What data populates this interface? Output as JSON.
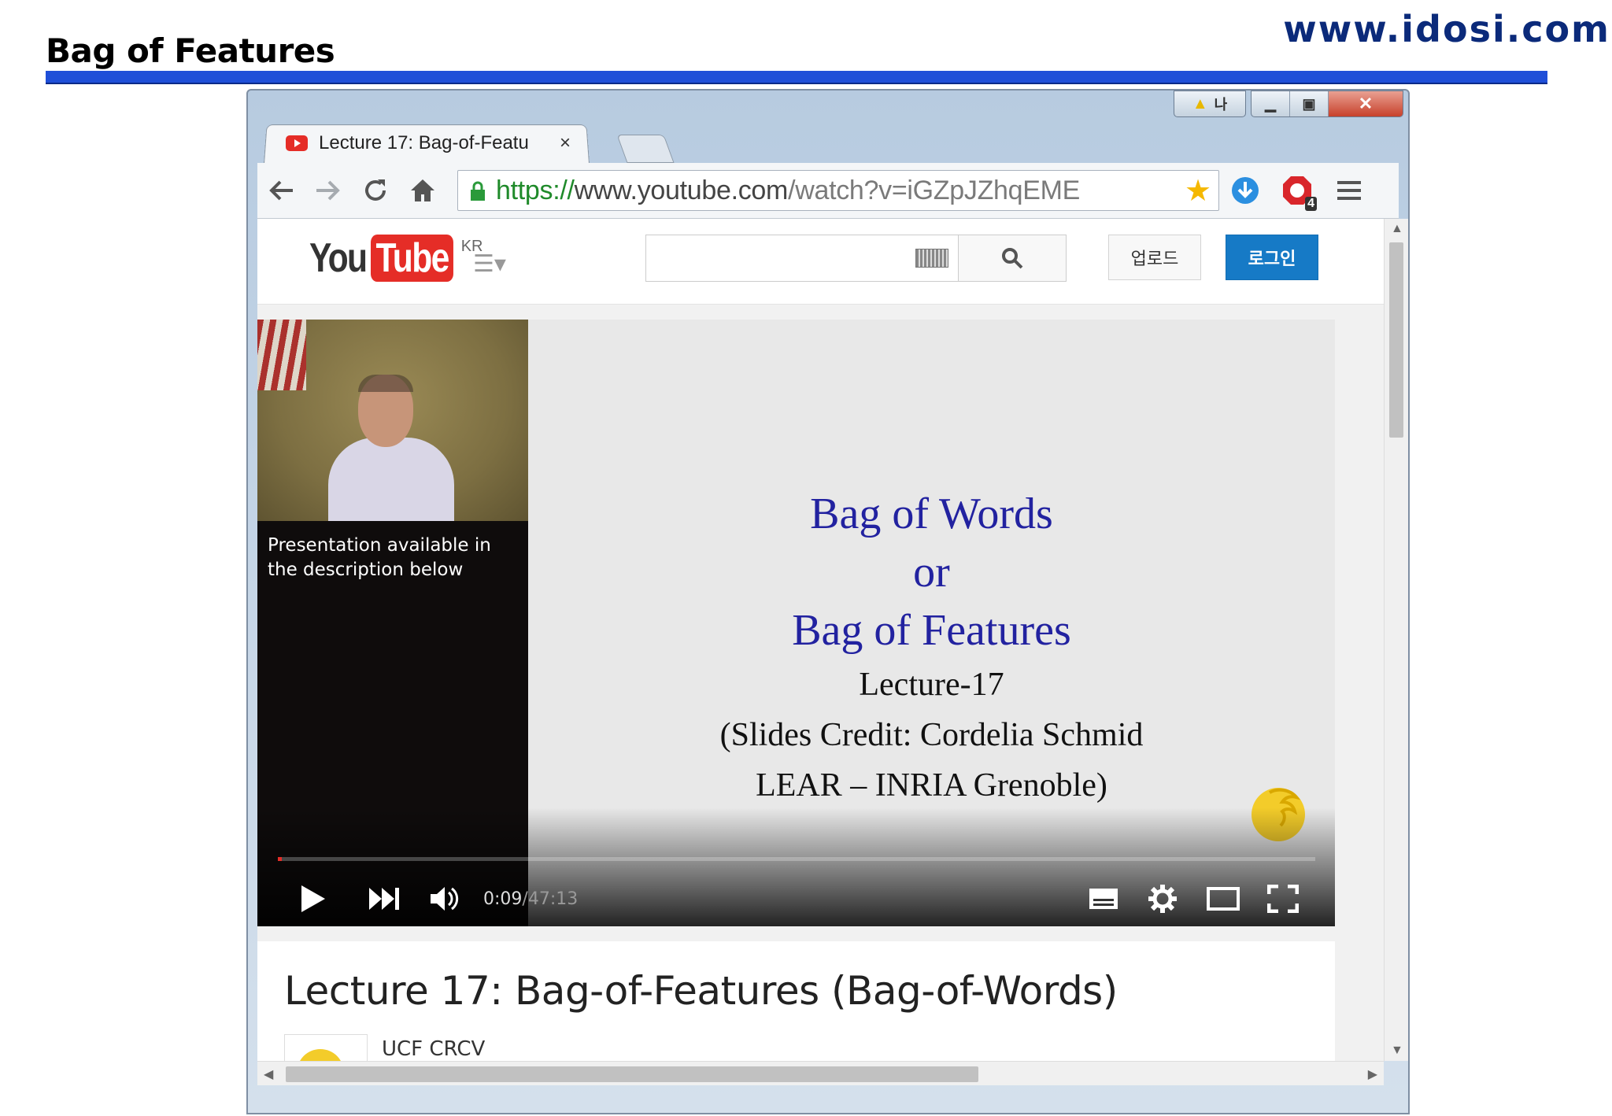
{
  "slide": {
    "title": "Bag of Features",
    "site_url": "www.idosi.com"
  },
  "window": {
    "notify_label": "나"
  },
  "browser": {
    "tab_title": "Lecture 17: Bag-of-Featu",
    "tab_close": "×",
    "url_proto": "https://",
    "url_domain": "www.youtube.com",
    "url_path": "/watch?v=iGZpJZhqEME",
    "extension_badge": "4"
  },
  "youtube": {
    "logo_you": "You",
    "logo_tube": "Tube",
    "logo_region": "KR",
    "search_placeholder": "",
    "upload_label": "업로드",
    "signin_label": "로그인"
  },
  "player": {
    "speaker_caption": "Presentation available in the description below",
    "slide_lines": {
      "line1": "Bag of Words",
      "line2": "or",
      "line3": "Bag of Features",
      "line4": "Lecture-17",
      "line5": "(Slides Credit: Cordelia Schmid",
      "line6": "LEAR – INRIA Grenoble)"
    },
    "current_time": "0:09",
    "separator": " / ",
    "duration": "47:13",
    "progress_fraction": 0.003
  },
  "video": {
    "title": "Lecture 17: Bag-of-Features (Bag-of-Words)",
    "channel": "UCF CRCV"
  },
  "colors": {
    "rule_blue": "#1f4fd8",
    "url_text": "#0b2a7a",
    "youtube_red": "#e52d27",
    "signin_blue": "#167ac6",
    "slide_blue": "#2222a0"
  },
  "icons": [
    "back-icon",
    "forward-icon",
    "reload-icon",
    "home-icon",
    "lock-icon",
    "star-icon",
    "download-icon",
    "adblock-icon",
    "menu-icon",
    "guide-icon",
    "keyboard-icon",
    "search-icon",
    "play-icon",
    "next-icon",
    "volume-icon",
    "captions-icon",
    "settings-icon",
    "theater-icon",
    "fullscreen-icon"
  ]
}
